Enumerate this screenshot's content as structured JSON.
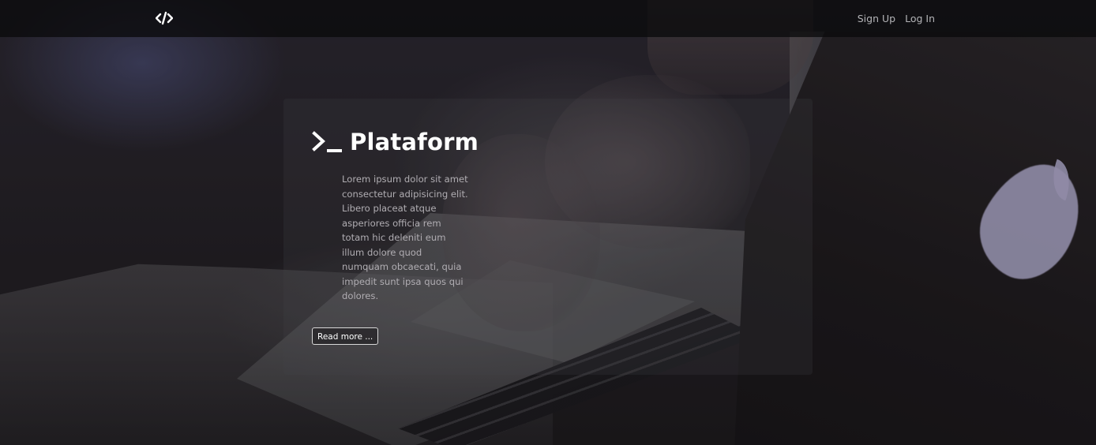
{
  "navbar": {
    "logo_icon": "code-icon",
    "links": {
      "signup": "Sign Up",
      "login": "Log In"
    }
  },
  "hero": {
    "title_icon": "terminal-prompt-icon",
    "title": "Plataform",
    "description": "Lorem ipsum dolor sit amet consectetur adipisicing elit. Libero placeat atque asperiores officia rem totam hic deleniti eum illum dolore quod numquam obcaecati, quia impedit sunt ipsa quos qui dolores.",
    "button_label": "Read more ..."
  },
  "colors": {
    "navbar_bg": "#0a0a0c",
    "text_primary": "#ffffff",
    "text_muted": "#b0adb2",
    "nav_link": "#b3b3b6"
  }
}
